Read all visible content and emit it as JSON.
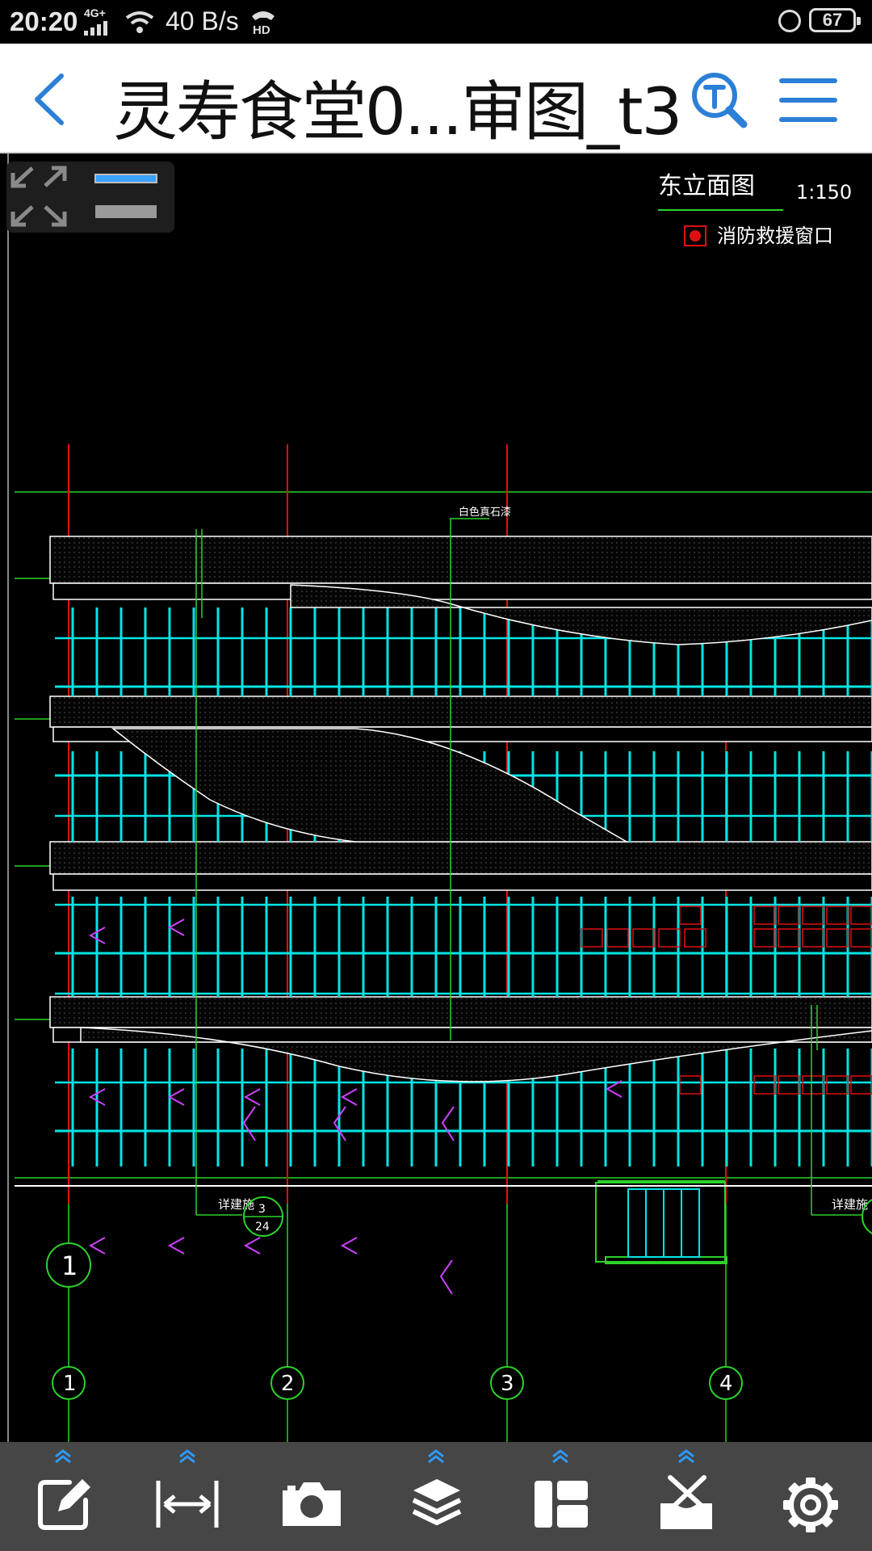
{
  "status_bar": {
    "time": "20:20",
    "network": "4G+",
    "speed": "40 B/s",
    "battery": "67"
  },
  "header": {
    "title": "灵寿食堂0...审图_t3",
    "back_icon": "back-arrow-icon",
    "search_icon": "text-search-icon",
    "menu_icon": "hamburger-menu-icon"
  },
  "drawing": {
    "view_title": "东立面图",
    "scale": "1:150",
    "legend_label": "消防救援窗口",
    "material_note": "白色真石漆",
    "detail_note_left": "详建施",
    "detail_note_right": "详建施",
    "detail_ref_top": "3",
    "detail_ref_bottom": "24",
    "axis_labels": [
      "1",
      "1",
      "2",
      "3",
      "4"
    ],
    "colors": {
      "background": "#000000",
      "curtain_wall": "#00e5e5",
      "axis_line": "#e01010",
      "green_line": "#2bd32b",
      "text": "#ffffff"
    }
  },
  "toolbar": {
    "tools": [
      {
        "name": "edit-icon",
        "has_expand": true
      },
      {
        "name": "measure-icon",
        "has_expand": true
      },
      {
        "name": "camera-icon",
        "has_expand": false
      },
      {
        "name": "layers-icon",
        "has_expand": true
      },
      {
        "name": "layout-icon",
        "has_expand": true
      },
      {
        "name": "tools-icon",
        "has_expand": true
      },
      {
        "name": "settings-icon",
        "has_expand": false
      }
    ]
  }
}
